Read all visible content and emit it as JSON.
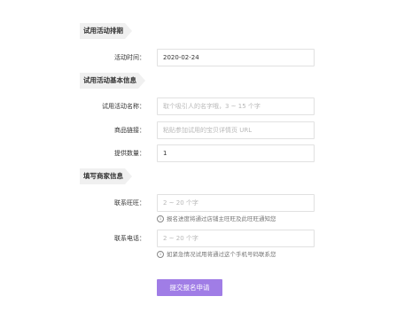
{
  "sections": {
    "trial_schedule": "试用活动排期",
    "trial_basic_info": "试用活动基本信息",
    "merchant_info": "填写商家信息"
  },
  "fields": {
    "activity_time": {
      "label": "活动时间：",
      "value": "2020-02-24"
    },
    "activity_name": {
      "label": "试用活动名称：",
      "placeholder": "取个吸引人的名字哦，3 ~ 15 个字"
    },
    "product_link": {
      "label": "商品链接：",
      "placeholder": "粘贴参加试用的宝贝详情页 URL"
    },
    "quantity": {
      "label": "提供数量：",
      "value": "1"
    },
    "wangwang": {
      "label": "联系旺旺：",
      "placeholder": "2 ~ 20 个字",
      "hint": "报名进度将通过店铺主旺旺及此旺旺通知您"
    },
    "phone": {
      "label": "联系电话：",
      "placeholder": "2 ~ 20 个字",
      "hint": "如紧急情况试用将通过这个手机号码联系您"
    }
  },
  "submit_label": "提交报名申请",
  "colors": {
    "accent": "#a07de6",
    "section_bg": "#f0f0f0",
    "border": "#e1e1e1"
  },
  "icons": {
    "hint_icon": "info-circle-icon",
    "hint_glyph": "i"
  }
}
